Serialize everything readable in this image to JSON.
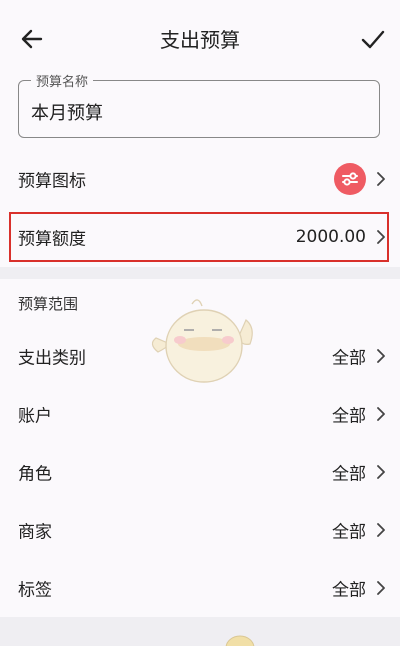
{
  "header": {
    "title": "支出预算"
  },
  "name_field": {
    "legend": "预算名称",
    "value": "本月预算"
  },
  "icon_row": {
    "label": "预算图标"
  },
  "amount_row": {
    "label": "预算额度",
    "value": "2000.00"
  },
  "scope": {
    "heading": "预算范围",
    "rows": [
      {
        "label": "支出类别",
        "value": "全部"
      },
      {
        "label": "账户",
        "value": "全部"
      },
      {
        "label": "角色",
        "value": "全部"
      },
      {
        "label": "商家",
        "value": "全部"
      },
      {
        "label": "标签",
        "value": "全部"
      }
    ]
  },
  "colors": {
    "accent": "#ef5b63",
    "highlight_border": "#d9302b",
    "band": "#efeef2"
  }
}
